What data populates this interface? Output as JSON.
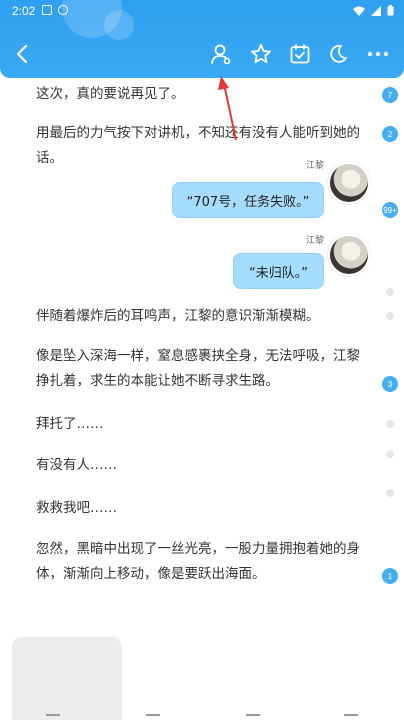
{
  "status_bar": {
    "time": "2:02"
  },
  "toolbar": {
    "back_icon": "chevron-left-icon",
    "icons": [
      "user-settings-icon",
      "star-icon",
      "calendar-check-icon",
      "moon-icon",
      "more-icon"
    ]
  },
  "messages": [
    {
      "type": "narration",
      "text": "这次，真的要说再见了。",
      "badge": "7"
    },
    {
      "type": "narration",
      "text": "用最后的力气按下对讲机，不知还有没有人能听到她的话。",
      "badge": "2"
    },
    {
      "type": "dialogue",
      "speaker": "江黎",
      "text": "“707号，任务失败。”",
      "badge": "99+"
    },
    {
      "type": "dialogue",
      "speaker": "江黎",
      "text": "“未归队。”"
    },
    {
      "type": "narration",
      "text": "伴随着爆炸后的耳鸣声，江黎的意识渐渐模糊。"
    },
    {
      "type": "narration",
      "text": "像是坠入深海一样，窒息感裹挟全身，无法呼吸，江黎挣扎着，求生的本能让她不断寻求生路。",
      "badge": "3"
    },
    {
      "type": "narration",
      "text": "拜托了……"
    },
    {
      "type": "narration",
      "text": "有没有人……"
    },
    {
      "type": "narration",
      "text": "救救我吧……"
    },
    {
      "type": "narration",
      "text": "忽然，黑暗中出现了一丝光亮，一股力量拥抱着她的身体，渐渐向上移动，像是要跃出海面。",
      "badge": "1"
    }
  ],
  "colors": {
    "header": "#2f9ff0",
    "badge": "#45aef0",
    "bubble": "#a5dcfb",
    "arrow": "#e53935"
  }
}
